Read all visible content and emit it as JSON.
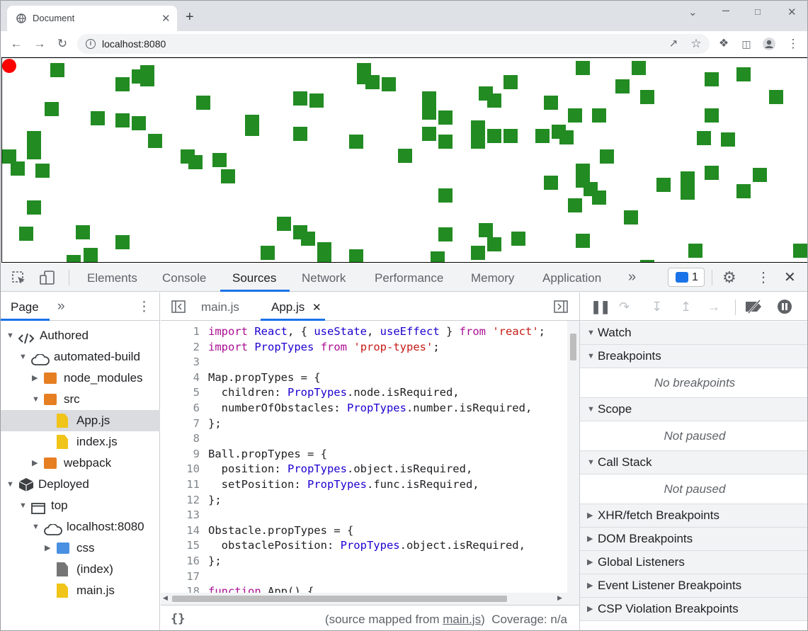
{
  "browser": {
    "tab_title": "Document",
    "tab_close": "✕",
    "new_tab": "+",
    "url": "localhost:8080",
    "window_controls": [
      "minimize",
      "maximize",
      "close"
    ]
  },
  "page": {
    "ball_color": "#ff0000",
    "obstacle_color": "#228b22"
  },
  "devtools": {
    "tabs": [
      "Elements",
      "Console",
      "Sources",
      "Network",
      "Performance",
      "Memory",
      "Application"
    ],
    "more_tabs": "»",
    "issues_count": "1",
    "navigator": {
      "tab": "Page",
      "more": "»",
      "tree": [
        {
          "label": "Authored",
          "level": 0,
          "icon": "code-icon",
          "expanded": true
        },
        {
          "label": "automated-build",
          "level": 1,
          "icon": "cloud-icon",
          "expanded": true
        },
        {
          "label": "node_modules",
          "level": 2,
          "icon": "folder-icon",
          "expanded": false
        },
        {
          "label": "src",
          "level": 2,
          "icon": "folder-icon",
          "expanded": true
        },
        {
          "label": "App.js",
          "level": 3,
          "icon": "file-icon",
          "selected": true
        },
        {
          "label": "index.js",
          "level": 3,
          "icon": "file-icon"
        },
        {
          "label": "webpack",
          "level": 2,
          "icon": "folder-icon",
          "expanded": false
        },
        {
          "label": "Deployed",
          "level": 0,
          "icon": "box-icon",
          "expanded": true
        },
        {
          "label": "top",
          "level": 1,
          "icon": "frame-icon",
          "expanded": true
        },
        {
          "label": "localhost:8080",
          "level": 2,
          "icon": "cloud-icon",
          "expanded": true
        },
        {
          "label": "css",
          "level": 3,
          "icon": "folder-icon",
          "expanded": false
        },
        {
          "label": "(index)",
          "level": 3,
          "icon": "file-icon"
        },
        {
          "label": "main.js",
          "level": 3,
          "icon": "file-icon"
        }
      ]
    },
    "editor": {
      "tabs": [
        "main.js",
        "App.js"
      ],
      "active_tab": "App.js",
      "close": "✕",
      "lines": [
        {
          "n": "1",
          "code": "import React, { useState, useEffect } from 'react';"
        },
        {
          "n": "2",
          "code": "import PropTypes from 'prop-types';"
        },
        {
          "n": "3",
          "code": ""
        },
        {
          "n": "4",
          "code": "Map.propTypes = {"
        },
        {
          "n": "5",
          "code": "  children: PropTypes.node.isRequired,"
        },
        {
          "n": "6",
          "code": "  numberOfObstacles: PropTypes.number.isRequired,"
        },
        {
          "n": "7",
          "code": "};"
        },
        {
          "n": "8",
          "code": ""
        },
        {
          "n": "9",
          "code": "Ball.propTypes = {"
        },
        {
          "n": "10",
          "code": "  position: PropTypes.object.isRequired,"
        },
        {
          "n": "11",
          "code": "  setPosition: PropTypes.func.isRequired,"
        },
        {
          "n": "12",
          "code": "};"
        },
        {
          "n": "13",
          "code": ""
        },
        {
          "n": "14",
          "code": "Obstacle.propTypes = {"
        },
        {
          "n": "15",
          "code": "  obstaclePosition: PropTypes.object.isRequired,"
        },
        {
          "n": "16",
          "code": "};"
        },
        {
          "n": "17",
          "code": ""
        },
        {
          "n": "18",
          "code": "function App() {"
        }
      ],
      "footer_braces": "{}",
      "source_mapped_prefix": "(source mapped from ",
      "source_mapped_file": "main.js",
      "source_mapped_suffix": ")",
      "coverage": "Coverage: n/a"
    },
    "debugger": {
      "sections": [
        {
          "title": "Watch",
          "expanded": true,
          "body": ""
        },
        {
          "title": "Breakpoints",
          "expanded": true,
          "body": "No breakpoints"
        },
        {
          "title": "Scope",
          "expanded": true,
          "body": "Not paused"
        },
        {
          "title": "Call Stack",
          "expanded": true,
          "body": "Not paused"
        },
        {
          "title": "XHR/fetch Breakpoints",
          "expanded": false
        },
        {
          "title": "DOM Breakpoints",
          "expanded": false
        },
        {
          "title": "Global Listeners",
          "expanded": false
        },
        {
          "title": "Event Listener Breakpoints",
          "expanded": false
        },
        {
          "title": "CSP Violation Breakpoints",
          "expanded": false
        }
      ]
    }
  }
}
